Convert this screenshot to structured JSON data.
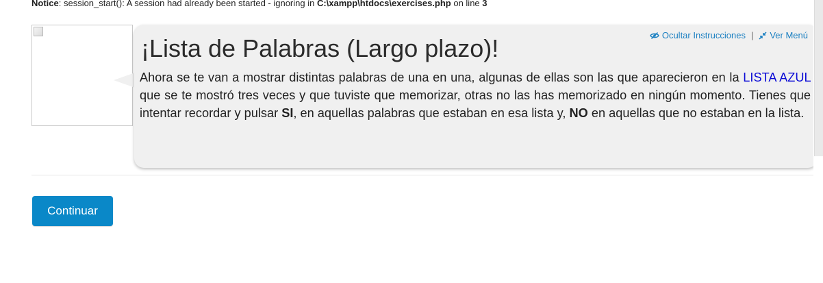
{
  "notice": {
    "label": "Notice",
    "message_pre": ": session_start(): A session had already been started - ignoring in ",
    "path": "C:\\xampp\\htdocs\\exercises.php",
    "line_pre": " on line ",
    "line_number": "3"
  },
  "instructions": {
    "hide_label": "Ocultar Instrucciones",
    "separator": "|",
    "menu_label": "Ver Menú",
    "title": "¡Lista de Palabras (Largo plazo)!",
    "text_part1": "Ahora se te van a mostrar distintas palabras de una en una, algunas de ellas son las que aparecieron en la ",
    "link_text": "LISTA AZUL",
    "text_part2": " que se te mostró tres veces y que tuviste que memorizar, otras no las has memorizado en ningún momento. Tienes que intentar recordar y pulsar ",
    "si": "SI",
    "text_part3": ", en aquellas palabras que estaban en esa lista y, ",
    "no": "NO",
    "text_part4": " en aquellas que no estaban en la lista."
  },
  "actions": {
    "continue_label": "Continuar"
  },
  "colors": {
    "accent": "#0a88c8",
    "link": "#1a7fc1",
    "list_link": "#0b0bd6",
    "bubble_bg": "#f0f0f0"
  },
  "icons": {
    "hide": "eye-slash-icon",
    "menu": "compress-arrows-icon",
    "avatar": "broken-image-icon"
  }
}
